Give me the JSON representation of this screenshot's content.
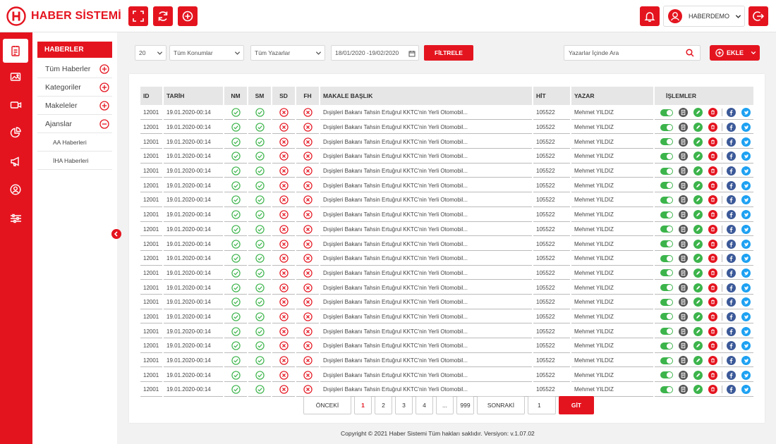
{
  "app": {
    "title": "HABER SİSTEMİ"
  },
  "user": {
    "name": "HABERDEMO"
  },
  "colors": {
    "brand": "#e4141f",
    "success": "#3cb44b",
    "facebook": "#3b5998",
    "twitter": "#1da1f2",
    "icon_dark": "#555555"
  },
  "topbar_icons": [
    "fullscreen-icon",
    "refresh-icon",
    "add-icon",
    "bell-icon",
    "user-icon",
    "logout-icon"
  ],
  "rail_icons": [
    "news-icon",
    "gallery-icon",
    "video-icon",
    "chart-icon",
    "megaphone-icon",
    "profile-icon",
    "sliders-icon"
  ],
  "submenu": {
    "header": "HABERLER",
    "items": [
      {
        "label": "Tüm Haberler",
        "toggle": "plus"
      },
      {
        "label": "Kategoriler",
        "toggle": "plus"
      },
      {
        "label": "Makeleler",
        "toggle": "plus"
      },
      {
        "label": "Ajanslar",
        "toggle": "minus"
      }
    ],
    "sub_items": [
      "AA Haberleri",
      "İHA Haberleri"
    ]
  },
  "filters": {
    "page_size": "20",
    "location": "Tüm Konumlar",
    "authors": "Tüm Yazarlar",
    "date_range": "18/01/2020 -19/02/2020",
    "filter_button": "FİLTRELE",
    "search_placeholder": "Yazarlar İçinde Ara",
    "add_button": "EKLE"
  },
  "table": {
    "columns": [
      "ID",
      "TARİH",
      "NM",
      "SM",
      "SD",
      "FH",
      "MAKALE BAŞLIK",
      "HİT",
      "YAZAR",
      "İŞLEMLER"
    ],
    "rows": [
      {
        "id": "12001",
        "date": "19.01.2020-00:14",
        "nm": true,
        "sm": true,
        "sd": false,
        "fh": false,
        "title": "Dışişleri Bakanı Tahsin Ertuğrul KKTC'nin Yerli Otomobil...",
        "hit": "105522",
        "author": "Mehmet YILDIZ",
        "active": true
      },
      {
        "id": "12001",
        "date": "19.01.2020-00:14",
        "nm": true,
        "sm": true,
        "sd": false,
        "fh": false,
        "title": "Dışişleri Bakanı Tahsin Ertuğrul KKTC'nin Yerli Otomobil...",
        "hit": "105522",
        "author": "Mehmet YILDIZ",
        "active": true
      },
      {
        "id": "12001",
        "date": "19.01.2020-00:14",
        "nm": true,
        "sm": true,
        "sd": false,
        "fh": false,
        "title": "Dışişleri Bakanı Tahsin Ertuğrul KKTC'nin Yerli Otomobil...",
        "hit": "105522",
        "author": "Mehmet YILDIZ",
        "active": true
      },
      {
        "id": "12001",
        "date": "19.01.2020-00:14",
        "nm": true,
        "sm": true,
        "sd": false,
        "fh": false,
        "title": "Dışişleri Bakanı Tahsin Ertuğrul KKTC'nin Yerli Otomobil...",
        "hit": "105522",
        "author": "Mehmet YILDIZ",
        "active": true
      },
      {
        "id": "12001",
        "date": "19.01.2020-00:14",
        "nm": true,
        "sm": true,
        "sd": false,
        "fh": false,
        "title": "Dışişleri Bakanı Tahsin Ertuğrul KKTC'nin Yerli Otomobil...",
        "hit": "105522",
        "author": "Mehmet YILDIZ",
        "active": true
      },
      {
        "id": "12001",
        "date": "19.01.2020-00:14",
        "nm": true,
        "sm": true,
        "sd": false,
        "fh": false,
        "title": "Dışişleri Bakanı Tahsin Ertuğrul KKTC'nin Yerli Otomobil...",
        "hit": "105522",
        "author": "Mehmet YILDIZ",
        "active": true
      },
      {
        "id": "12001",
        "date": "19.01.2020-00:14",
        "nm": true,
        "sm": true,
        "sd": false,
        "fh": false,
        "title": "Dışişleri Bakanı Tahsin Ertuğrul KKTC'nin Yerli Otomobil...",
        "hit": "105522",
        "author": "Mehmet YILDIZ",
        "active": true
      },
      {
        "id": "12001",
        "date": "19.01.2020-00:14",
        "nm": true,
        "sm": true,
        "sd": false,
        "fh": false,
        "title": "Dışişleri Bakanı Tahsin Ertuğrul KKTC'nin Yerli Otomobil...",
        "hit": "105522",
        "author": "Mehmet YILDIZ",
        "active": true
      },
      {
        "id": "12001",
        "date": "19.01.2020-00:14",
        "nm": true,
        "sm": true,
        "sd": false,
        "fh": false,
        "title": "Dışişleri Bakanı Tahsin Ertuğrul KKTC'nin Yerli Otomobil...",
        "hit": "105522",
        "author": "Mehmet YILDIZ",
        "active": true
      },
      {
        "id": "12001",
        "date": "19.01.2020-00:14",
        "nm": true,
        "sm": true,
        "sd": false,
        "fh": false,
        "title": "Dışişleri Bakanı Tahsin Ertuğrul KKTC'nin Yerli Otomobil...",
        "hit": "105522",
        "author": "Mehmet YILDIZ",
        "active": true
      },
      {
        "id": "12001",
        "date": "19.01.2020-00:14",
        "nm": true,
        "sm": true,
        "sd": false,
        "fh": false,
        "title": "Dışişleri Bakanı Tahsin Ertuğrul KKTC'nin Yerli Otomobil...",
        "hit": "105522",
        "author": "Mehmet YILDIZ",
        "active": true
      },
      {
        "id": "12001",
        "date": "19.01.2020-00:14",
        "nm": true,
        "sm": true,
        "sd": false,
        "fh": false,
        "title": "Dışişleri Bakanı Tahsin Ertuğrul KKTC'nin Yerli Otomobil...",
        "hit": "105522",
        "author": "Mehmet YILDIZ",
        "active": true
      },
      {
        "id": "12001",
        "date": "19.01.2020-00:14",
        "nm": true,
        "sm": true,
        "sd": false,
        "fh": false,
        "title": "Dışişleri Bakanı Tahsin Ertuğrul KKTC'nin Yerli Otomobil...",
        "hit": "105522",
        "author": "Mehmet YILDIZ",
        "active": true
      },
      {
        "id": "12001",
        "date": "19.01.2020-00:14",
        "nm": true,
        "sm": true,
        "sd": false,
        "fh": false,
        "title": "Dışişleri Bakanı Tahsin Ertuğrul KKTC'nin Yerli Otomobil...",
        "hit": "105522",
        "author": "Mehmet YILDIZ",
        "active": true
      },
      {
        "id": "12001",
        "date": "19.01.2020-00:14",
        "nm": true,
        "sm": true,
        "sd": false,
        "fh": false,
        "title": "Dışişleri Bakanı Tahsin Ertuğrul KKTC'nin Yerli Otomobil...",
        "hit": "105522",
        "author": "Mehmet YILDIZ",
        "active": true
      },
      {
        "id": "12001",
        "date": "19.01.2020-00:14",
        "nm": true,
        "sm": true,
        "sd": false,
        "fh": false,
        "title": "Dışişleri Bakanı Tahsin Ertuğrul KKTC'nin Yerli Otomobil...",
        "hit": "105522",
        "author": "Mehmet YILDIZ",
        "active": true
      },
      {
        "id": "12001",
        "date": "19.01.2020-00:14",
        "nm": true,
        "sm": true,
        "sd": false,
        "fh": false,
        "title": "Dışişleri Bakanı Tahsin Ertuğrul KKTC'nin Yerli Otomobil...",
        "hit": "105522",
        "author": "Mehmet YILDIZ",
        "active": true
      },
      {
        "id": "12001",
        "date": "19.01.2020-00:14",
        "nm": true,
        "sm": true,
        "sd": false,
        "fh": false,
        "title": "Dışişleri Bakanı Tahsin Ertuğrul KKTC'nin Yerli Otomobil...",
        "hit": "105522",
        "author": "Mehmet YILDIZ",
        "active": true
      },
      {
        "id": "12001",
        "date": "19.01.2020-00:14",
        "nm": true,
        "sm": true,
        "sd": false,
        "fh": false,
        "title": "Dışişleri Bakanı Tahsin Ertuğrul KKTC'nin Yerli Otomobil...",
        "hit": "105522",
        "author": "Mehmet YILDIZ",
        "active": true
      },
      {
        "id": "12001",
        "date": "19.01.2020-00:14",
        "nm": true,
        "sm": true,
        "sd": false,
        "fh": false,
        "title": "Dışişleri Bakanı Tahsin Ertuğrul KKTC'nin Yerli Otomobil...",
        "hit": "105522",
        "author": "Mehmet YILDIZ",
        "active": true
      }
    ]
  },
  "pagination": {
    "prev": "ÖNCEKİ",
    "pages": [
      "1",
      "2",
      "3",
      "4",
      "...",
      "999"
    ],
    "current": "1",
    "next": "SONRAKİ",
    "goto_value": "1",
    "go_button": "GİT"
  },
  "footer": {
    "text": "Copyright © 2021 Haber  Sistemi  Tüm hakları saklıdır. Versiyon: v.1.07.02"
  }
}
